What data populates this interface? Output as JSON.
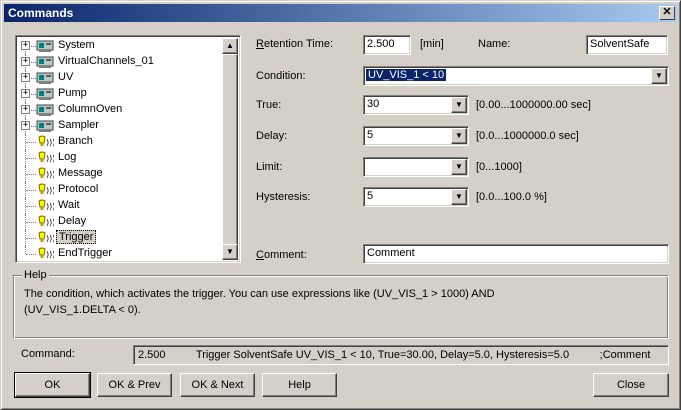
{
  "window": {
    "title": "Commands",
    "close_glyph": "✕"
  },
  "tree": {
    "items": [
      {
        "label": "System",
        "expandable": true,
        "icon": "device-icon"
      },
      {
        "label": "VirtualChannels_01",
        "expandable": true,
        "icon": "device-icon"
      },
      {
        "label": "UV",
        "expandable": true,
        "icon": "device-icon"
      },
      {
        "label": "Pump",
        "expandable": true,
        "icon": "device-icon"
      },
      {
        "label": "ColumnOven",
        "expandable": true,
        "icon": "device-icon"
      },
      {
        "label": "Sampler",
        "expandable": true,
        "icon": "device-icon"
      },
      {
        "label": "Branch",
        "expandable": false,
        "icon": "trigger-icon"
      },
      {
        "label": "Log",
        "expandable": false,
        "icon": "trigger-icon"
      },
      {
        "label": "Message",
        "expandable": false,
        "icon": "trigger-icon"
      },
      {
        "label": "Protocol",
        "expandable": false,
        "icon": "trigger-icon"
      },
      {
        "label": "Wait",
        "expandable": false,
        "icon": "trigger-icon"
      },
      {
        "label": "Delay",
        "expandable": false,
        "icon": "trigger-icon"
      },
      {
        "label": "Trigger",
        "expandable": false,
        "icon": "trigger-icon",
        "selected": true
      },
      {
        "label": "EndTrigger",
        "expandable": false,
        "icon": "trigger-icon"
      }
    ],
    "expander_glyph": "+"
  },
  "form": {
    "retention_time": {
      "label_ul": "R",
      "label_rest": "etention Time:",
      "value": "2.500",
      "unit": "[min]"
    },
    "name": {
      "label": "Name:",
      "value": "SolventSafe"
    },
    "condition": {
      "label": "Condition:",
      "value": "UV_VIS_1 < 10"
    },
    "true_field": {
      "label": "True:",
      "value": "30",
      "range": "[0.00...1000000.00 sec]"
    },
    "delay": {
      "label": "Delay:",
      "value": "5",
      "range": "[0.0...1000000.0 sec]"
    },
    "limit": {
      "label": "Limit:",
      "value": "",
      "range": "[0...1000]"
    },
    "hysteresis": {
      "label": "Hysteresis:",
      "value": "5",
      "range": "[0.0...100.0 %]"
    },
    "comment": {
      "label_ul": "C",
      "label_rest": "omment:",
      "value": "Comment"
    }
  },
  "help": {
    "title": "Help",
    "text": "The condition, which activates the trigger. You can use expressions like (UV_VIS_1 > 1000) AND (UV_VIS_1.DELTA < 0)."
  },
  "command": {
    "label": "Command:",
    "value": "2.500          Trigger SolventSafe UV_VIS_1 < 10, True=30.00, Delay=5.0, Hysteresis=5.0          ;Comment"
  },
  "buttons": {
    "ok": "OK",
    "ok_prev": "OK & Prev",
    "ok_next": "OK & Next",
    "help": "Help",
    "close": "Close"
  },
  "glyphs": {
    "dropdown": "▼",
    "scroll_up": "▲",
    "scroll_down": "▼"
  }
}
